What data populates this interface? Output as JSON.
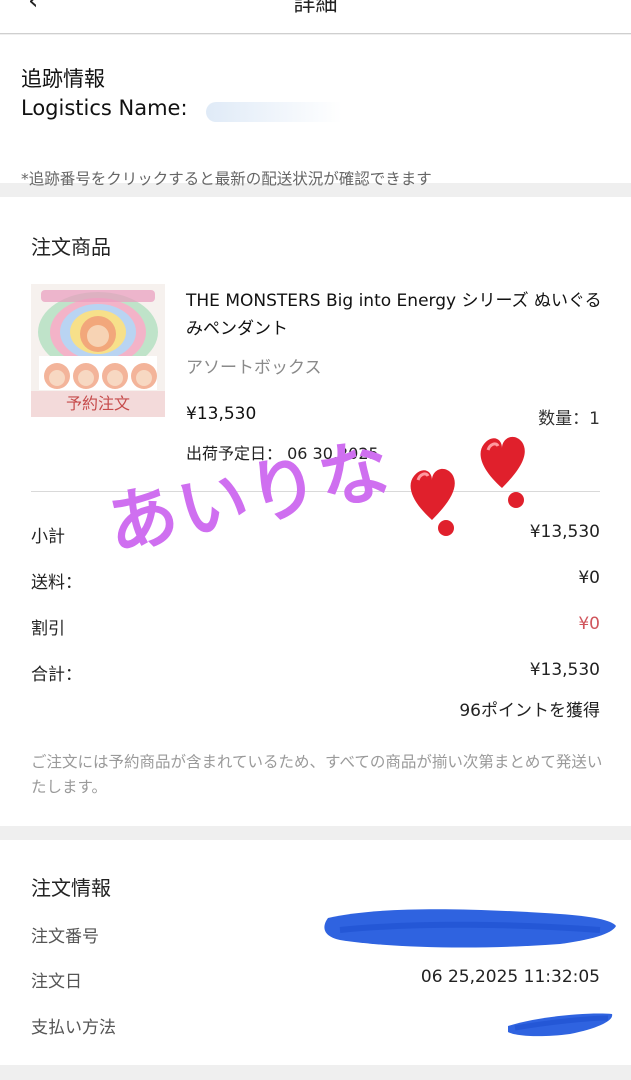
{
  "header": {
    "title": "詳細",
    "back_icon": "chevron-left-icon"
  },
  "tracking": {
    "title": "追跡情報",
    "logistics_label": "Logistics Name:",
    "note": "*追跡番号をクリックすると最新の配送状況が確認できます"
  },
  "order_items": {
    "title": "注文商品",
    "product": {
      "name": "THE MONSTERS Big into Energy シリーズ ぬいぐるみペンダント",
      "variant": "アソートボックス",
      "badge": "予約注文",
      "price": "¥13,530",
      "quantity": "数量：1",
      "ship_date": "出荷予定日： 06 30,2025"
    },
    "summary": {
      "subtotal_label": "小計",
      "subtotal_value": "¥13,530",
      "shipping_label": "送料：",
      "shipping_value": "¥0",
      "discount_label": "割引",
      "discount_value": "¥0",
      "total_label": "合計：",
      "total_value": "¥13,530",
      "points": "96ポイントを獲得"
    },
    "notice": "ご注文には予約商品が含まれているため、すべての商品が揃い次第まとめて発送いたします。"
  },
  "order_info": {
    "title": "注文情報",
    "number_label": "注文番号",
    "date_label": "注文日",
    "date_value": "06 25,2025 11:32:05",
    "payment_label": "支払い方法"
  },
  "overlay": {
    "handwriting": "あいりな",
    "heart_icon": "heart-exclamation-icon",
    "handwriting_color": "#cf6ff0",
    "redaction_color": "#2f63e0"
  },
  "colors": {
    "discount_red": "#d0555c",
    "badge_bg": "#f3dada"
  }
}
